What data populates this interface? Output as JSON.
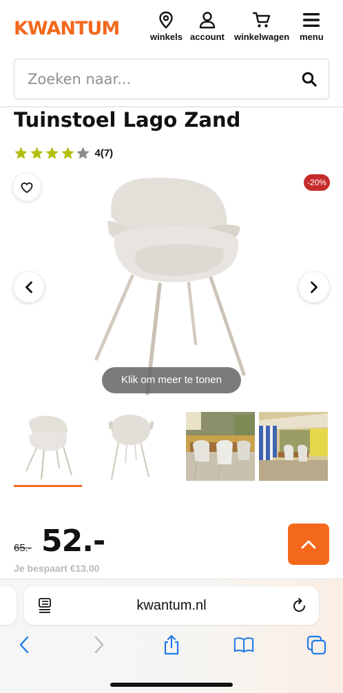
{
  "header": {
    "logo": "KWANTUM",
    "nav": {
      "stores": "winkels",
      "account": "account",
      "cart": "winkelwagen",
      "menu": "menu"
    },
    "brand_color": "#f4681c"
  },
  "search": {
    "placeholder": "Zoeken naar..."
  },
  "product": {
    "title": "Tuinstoel Lago Zand",
    "rating": {
      "score": 4,
      "max": 5,
      "text": "4(7)"
    },
    "discount_badge": "-20%",
    "image_hint": "Klik om meer te tonen",
    "thumbnails": [
      {
        "icon": "chair-front-thumbnail",
        "selected": true
      },
      {
        "icon": "chair-back-thumbnail",
        "selected": false
      },
      {
        "icon": "dining-table-photo-thumbnail",
        "selected": false
      },
      {
        "icon": "garden-photo-thumbnail",
        "selected": false
      }
    ]
  },
  "price": {
    "old": "65.-",
    "new": "52.-",
    "savings": "Je bespaart €13.00"
  },
  "browser": {
    "url": "kwantum.nl"
  },
  "icons": {
    "heart": "heart-icon",
    "chevron_left": "chevron-left-icon",
    "chevron_right": "chevron-right-icon",
    "chevron_up": "chevron-up-icon",
    "share": "share-icon",
    "bookmarks": "book-icon",
    "tabs": "tabs-icon",
    "reload": "reload-icon",
    "reader": "reader-icon"
  },
  "colors": {
    "accent": "#f4681c",
    "star": "#b4bd12",
    "star_empty": "#8a8a8a",
    "badge": "#c62b2b",
    "ios_blue": "#1f7ae8"
  }
}
